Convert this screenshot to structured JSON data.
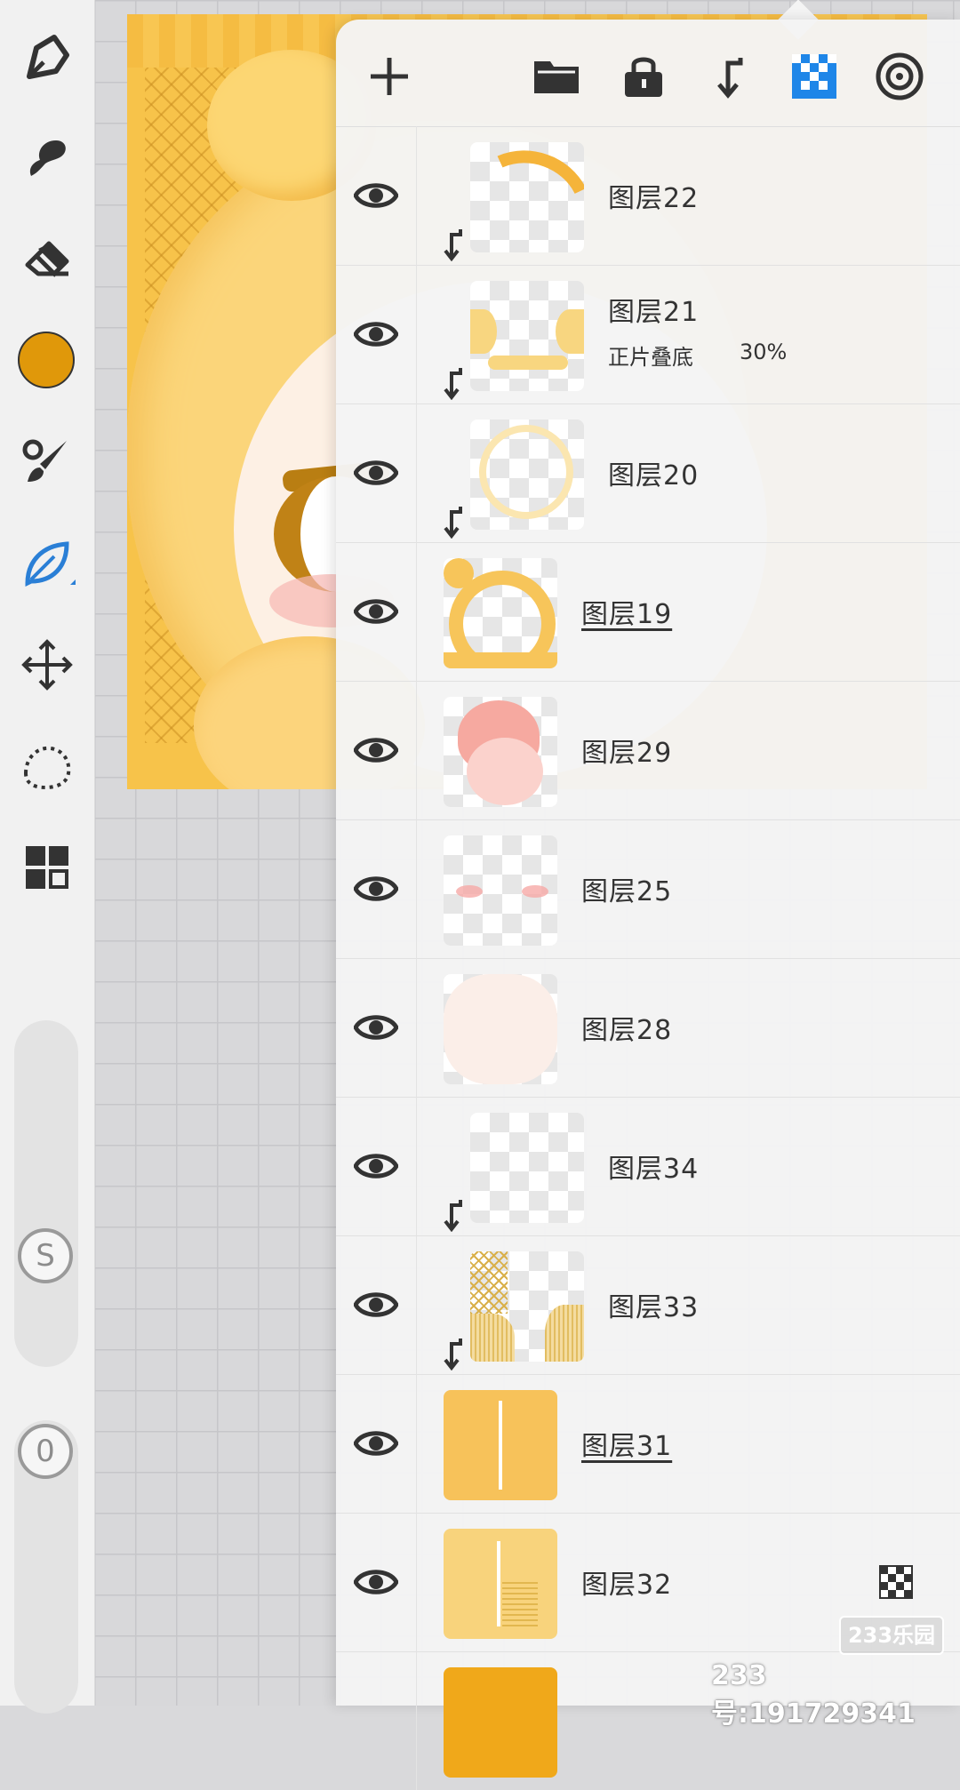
{
  "canvas": {
    "artwork_bg": "#f7c34a"
  },
  "toolbar": {
    "tools": [
      {
        "name": "pen-icon"
      },
      {
        "name": "smudge-icon"
      },
      {
        "name": "eraser-icon"
      },
      {
        "name": "color-swatch"
      },
      {
        "name": "brush-settings-icon"
      },
      {
        "name": "leaf-brush-icon"
      },
      {
        "name": "transform-icon"
      },
      {
        "name": "lasso-icon"
      },
      {
        "name": "layers-grid-icon"
      }
    ],
    "current_color": "#e0980a",
    "size_label": "S",
    "opacity_label": "0"
  },
  "panel": {
    "actions": [
      "add-layer-icon",
      "folder-icon",
      "lock-icon",
      "clip-icon",
      "checker-icon",
      "target-icon"
    ],
    "layers": [
      {
        "name": "图层22",
        "clipped": true
      },
      {
        "name": "图层21",
        "clipped": true,
        "blend_mode": "正片叠底",
        "opacity": "30%"
      },
      {
        "name": "图层20",
        "clipped": true
      },
      {
        "name": "图层19",
        "clipped": false,
        "selected_underline": true
      },
      {
        "name": "图层29",
        "clipped": false
      },
      {
        "name": "图层25",
        "clipped": false
      },
      {
        "name": "图层28",
        "clipped": false
      },
      {
        "name": "图层34",
        "clipped": true
      },
      {
        "name": "图层33",
        "clipped": true
      },
      {
        "name": "图层31",
        "clipped": false,
        "selected_underline": true
      },
      {
        "name": "图层32",
        "clipped": false,
        "alpha_lock": true
      }
    ]
  },
  "watermark": {
    "logo": "233乐园",
    "text": "233号:191729341"
  }
}
